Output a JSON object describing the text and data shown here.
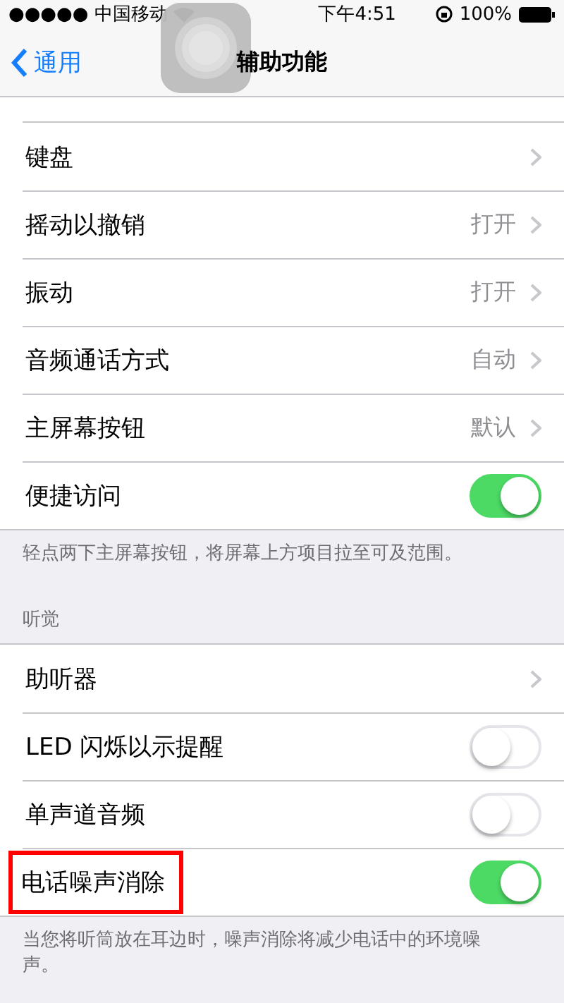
{
  "status_bar": {
    "carrier": "●●●●● 中国移动",
    "time": "下午4:51",
    "battery": "100%"
  },
  "nav": {
    "back": "通用",
    "title": "辅助功能"
  },
  "sections": [
    {
      "rows": [
        {
          "kind": "link",
          "label": "键盘"
        },
        {
          "kind": "link",
          "label": "摇动以撤销",
          "value": "打开"
        },
        {
          "kind": "link",
          "label": "振动",
          "value": "打开"
        },
        {
          "kind": "link",
          "label": "音频通话方式",
          "value": "自动"
        },
        {
          "kind": "link",
          "label": "主屏幕按钮",
          "value": "默认"
        },
        {
          "kind": "switch",
          "label": "便捷访问",
          "on": true
        }
      ],
      "footer": "轻点两下主屏幕按钮，将屏幕上方项目拉至可及范围。"
    },
    {
      "header": "听觉",
      "rows": [
        {
          "kind": "link",
          "label": "助听器"
        },
        {
          "kind": "switch",
          "label": "LED 闪烁以示提醒",
          "on": false
        },
        {
          "kind": "switch",
          "label": "单声道音频",
          "on": false
        },
        {
          "kind": "switch",
          "label": "电话噪声消除",
          "on": true,
          "highlighted": true
        }
      ],
      "footer": "当您将听筒放在耳边时，噪声消除将减少电话中的环境噪声。"
    }
  ]
}
